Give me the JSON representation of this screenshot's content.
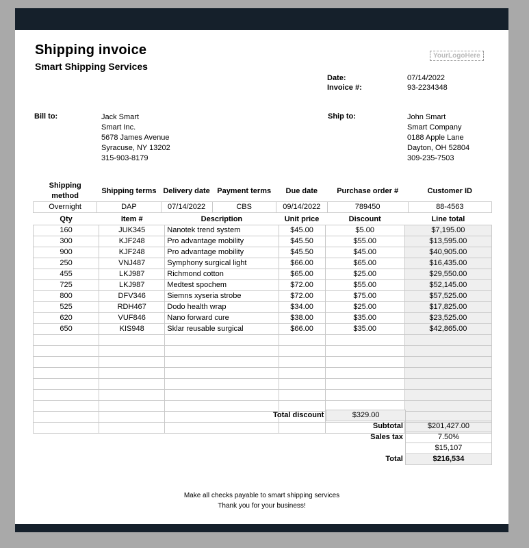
{
  "header": {
    "title": "Shipping invoice",
    "company_name": "Smart Shipping Services",
    "logo_text": "YourLogoHere"
  },
  "invoice_meta": {
    "date_label": "Date:",
    "date_value": "07/14/2022",
    "invoice_label": "Invoice #:",
    "invoice_value": "93-2234348"
  },
  "bill_to": {
    "label": "Bill to:",
    "lines": [
      "Jack Smart",
      "Smart Inc.",
      "5678 James Avenue",
      "Syracuse, NY 13202",
      "315-903-8179"
    ]
  },
  "ship_to": {
    "label": "Ship to:",
    "lines": [
      "John Smart",
      "Smart Company",
      "0188 Apple Lane",
      "Dayton, OH 52804",
      "309-235-7503"
    ]
  },
  "shipment": {
    "headers": [
      "Shipping method",
      "Shipping terms",
      "Delivery date",
      "Payment terms",
      "Due date",
      "Purchase order #",
      "Customer ID"
    ],
    "values": [
      "Overnight",
      "DAP",
      "07/14/2022",
      "CBS",
      "09/14/2022",
      "789450",
      "88-4563"
    ]
  },
  "items": {
    "headers": [
      "Qty",
      "Item #",
      "Description",
      "Unit price",
      "Discount",
      "Line total"
    ],
    "rows": [
      [
        "160",
        "JUK345",
        "Nanotek trend system",
        "$45.00",
        "$5.00",
        "$7,195.00"
      ],
      [
        "300",
        "KJF248",
        "Pro advantage mobility",
        "$45.50",
        "$55.00",
        "$13,595.00"
      ],
      [
        "900",
        "KJF248",
        "Pro advantage mobility",
        "$45.50",
        "$45.00",
        "$40,905.00"
      ],
      [
        "250",
        "VNJ487",
        "Symphony surgical light",
        "$66.00",
        "$65.00",
        "$16,435.00"
      ],
      [
        "455",
        "LKJ987",
        "Richmond cotton",
        "$65.00",
        "$25.00",
        "$29,550.00"
      ],
      [
        "725",
        "LKJ987",
        "Medtest spochem",
        "$72.00",
        "$55.00",
        "$52,145.00"
      ],
      [
        "800",
        "DFV346",
        "Siemns xyseria strobe",
        "$72.00",
        "$75.00",
        "$57,525.00"
      ],
      [
        "525",
        "RDH467",
        "Dodo health wrap",
        "$34.00",
        "$25.00",
        "$17,825.00"
      ],
      [
        "620",
        "VUF846",
        "Nano forward cure",
        "$38.00",
        "$35.00",
        "$23,525.00"
      ],
      [
        "650",
        "KIS948",
        "Sklar reusable surgical",
        "$66.00",
        "$35.00",
        "$42,865.00"
      ]
    ],
    "empty_rows": 9
  },
  "totals": {
    "total_discount_label": "Total discount",
    "total_discount_value": "$329.00",
    "subtotal_label": "Subtotal",
    "subtotal_value": "$201,427.00",
    "sales_tax_label": "Sales tax",
    "sales_tax_value": "7.50%",
    "sales_tax_amount": "$15,107",
    "total_label": "Total",
    "total_value": "$216,534"
  },
  "footer": {
    "line1": "Make all checks payable to smart shipping services",
    "line2": "Thank you for your business!"
  }
}
